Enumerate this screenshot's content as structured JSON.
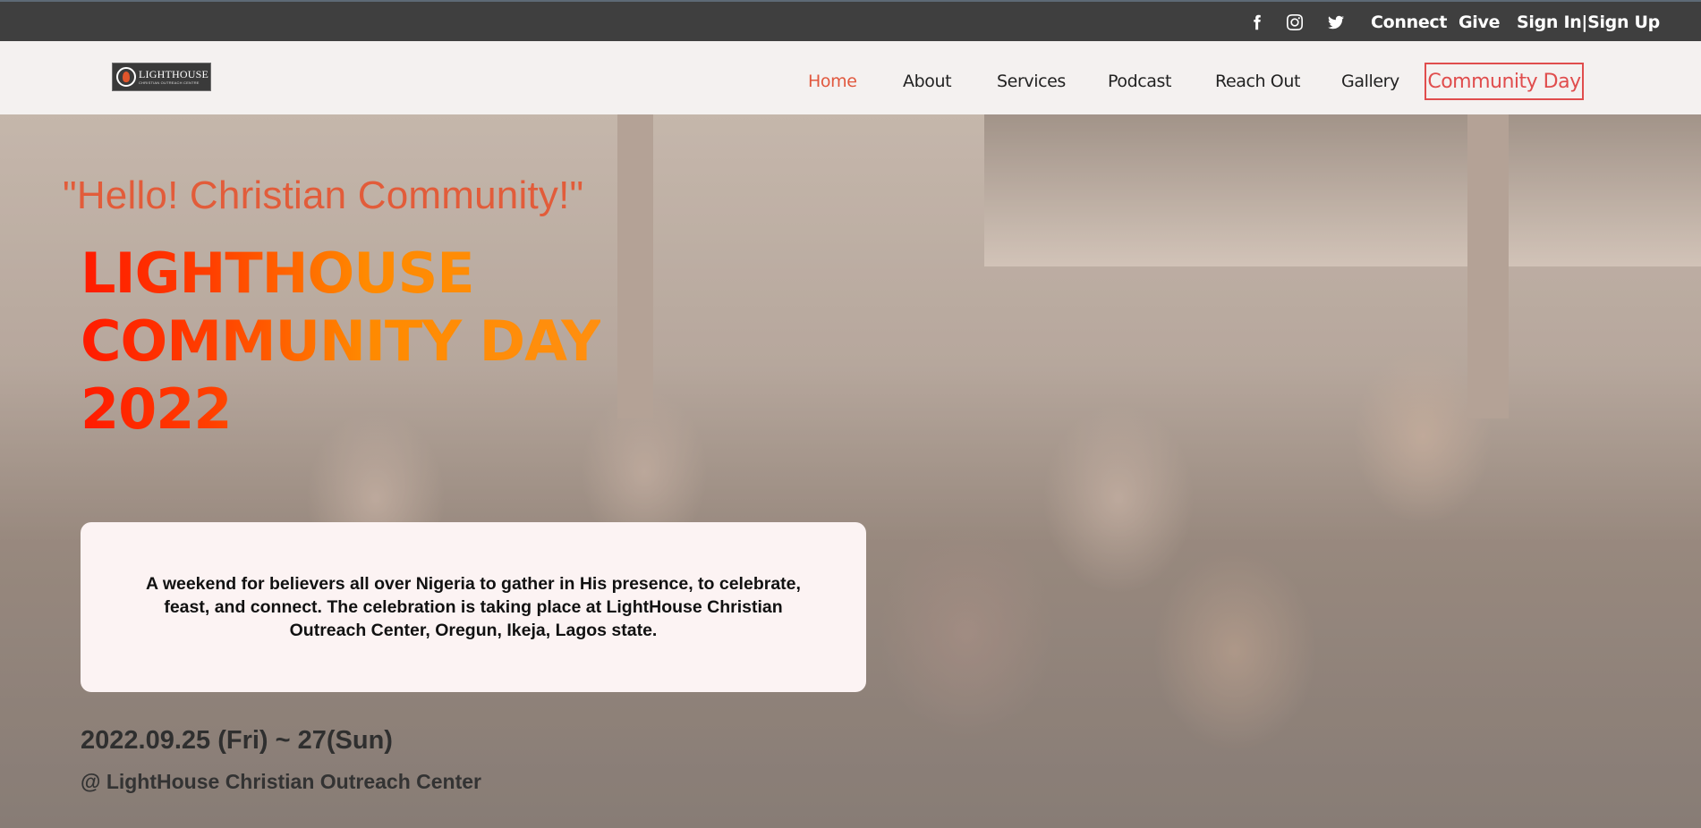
{
  "topbar": {
    "social": [
      {
        "icon": "facebook-icon"
      },
      {
        "icon": "instagram-icon"
      },
      {
        "icon": "twitter-icon"
      }
    ],
    "links": {
      "connect": "Connect",
      "give": "Give",
      "signin": "Sign In|Sign Up"
    }
  },
  "header": {
    "logo": {
      "main": "LIGHTHOUSE",
      "sub": "CHRISTIAN OUTREACH CENTRE"
    },
    "nav": {
      "home": "Home",
      "about": "About",
      "services": "Services",
      "podcast": "Podcast",
      "reach_out": "Reach Out",
      "gallery": "Gallery",
      "community_day": "Community Day"
    }
  },
  "hero": {
    "greeting": "\"Hello! Christian Community!\"",
    "title": {
      "line1": "LIGHTHOUSE",
      "line2": "COMMUNITY DAY",
      "line3": "2022"
    },
    "description": "A weekend for believers all over Nigeria to gather in His presence, to celebrate, feast, and connect. The celebration is taking place at LightHouse Christian Outreach Center, Oregun, Ikeja, Lagos state.",
    "dates": "2022.09.25 (Fri) ~ 27(Sun)",
    "venue": "@ LightHouse Christian Outreach Center"
  },
  "colors": {
    "topbar_bg": "#3f3f3f",
    "navbar_bg": "#f4f1f0",
    "accent": "#e1583e",
    "cta_border": "#e04d4d"
  }
}
